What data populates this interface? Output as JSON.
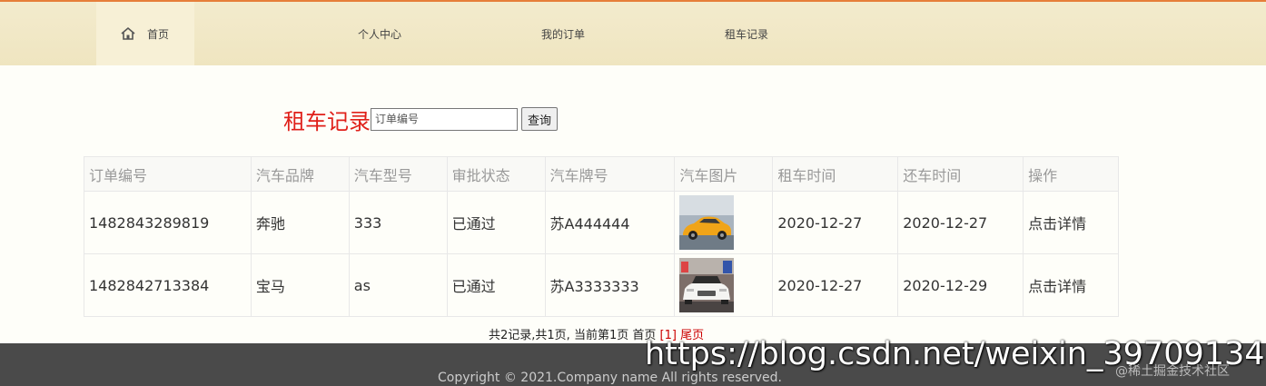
{
  "nav": {
    "home_label": "首页",
    "items": [
      {
        "label": "个人中心"
      },
      {
        "label": "我的订单"
      },
      {
        "label": "租车记录"
      }
    ]
  },
  "search": {
    "title": "租车记录",
    "placeholder": "订单编号",
    "button_label": "查询"
  },
  "table": {
    "headers": [
      "订单编号",
      "汽车品牌",
      "汽车型号",
      "审批状态",
      "汽车牌号",
      "汽车图片",
      "租车时间",
      "还车时间",
      "操作"
    ],
    "rows": [
      {
        "order_no": "1482843289819",
        "brand": "奔驰",
        "model": "333",
        "status": "已通过",
        "plate": "苏A444444",
        "image": "orange-sports-car",
        "rent_date": "2020-12-27",
        "return_date": "2020-12-27",
        "action": "点击详情"
      },
      {
        "order_no": "1482842713384",
        "brand": "宝马",
        "model": "as",
        "status": "已通过",
        "plate": "苏A3333333",
        "image": "white-sedan",
        "rent_date": "2020-12-27",
        "return_date": "2020-12-29",
        "action": "点击详情"
      }
    ]
  },
  "pagination": {
    "summary": "共2记录,共1页, 当前第1页",
    "first": "首页",
    "current": "[1]",
    "last": "尾页"
  },
  "footer": {
    "copyright": "Copyright © 2021.Company name All rights reserved."
  },
  "watermark": {
    "url": "https://blog.csdn.net/weixin_39709134",
    "site": "@稀土掘金技术社区"
  },
  "colors": {
    "accent_red": "#e0201a",
    "nav_bg": "#efe5c0",
    "footer_bg": "#4a4a4a"
  }
}
